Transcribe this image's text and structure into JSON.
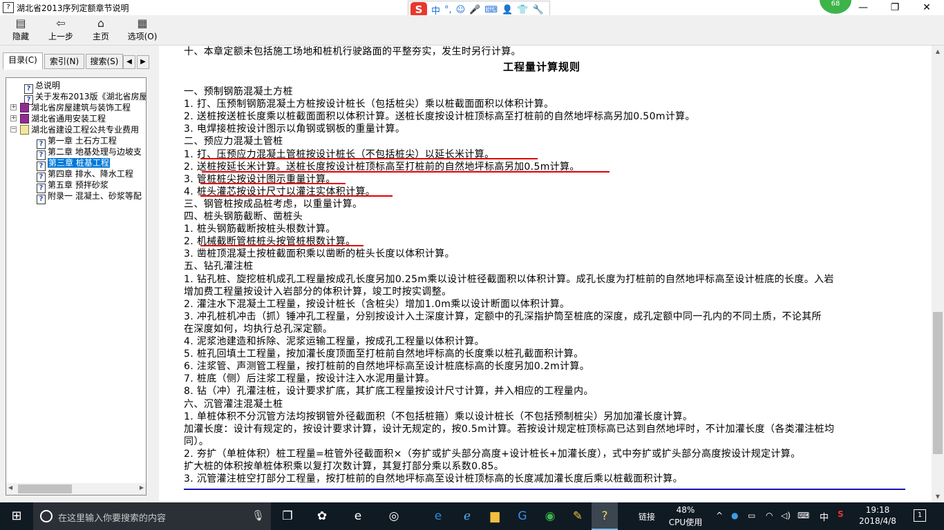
{
  "window": {
    "title": "湖北省2013序列定额章节说明",
    "minimize": "—",
    "restore": "❐",
    "close": "✕"
  },
  "ime": {
    "logo": "S",
    "items": [
      "中",
      "°,",
      "☺",
      "🎤",
      "⌨",
      "👤",
      "👕",
      "🔧"
    ]
  },
  "badge": "68",
  "toolbar": {
    "buttons": [
      {
        "label": "隐藏",
        "icon": "▤"
      },
      {
        "label": "上一步",
        "icon": "⇦"
      },
      {
        "label": "主页",
        "icon": "⌂"
      },
      {
        "label": "选项(O)",
        "icon": "▦"
      }
    ]
  },
  "tabs": [
    {
      "label": "目录(C)"
    },
    {
      "label": "索引(N)"
    },
    {
      "label": "搜索(S)"
    }
  ],
  "tab_arrows": [
    "◀",
    "▶"
  ],
  "tree": [
    {
      "label": "总说明",
      "type": "page",
      "indent": 1
    },
    {
      "label": "关于发布2013版《湖北省房屋",
      "type": "page",
      "indent": 1
    },
    {
      "label": "湖北省房屋建筑与装饰工程",
      "type": "book",
      "indent": 0,
      "expander": "+"
    },
    {
      "label": "湖北省通用安装工程",
      "type": "book",
      "indent": 0,
      "expander": "+"
    },
    {
      "label": "湖北省建设工程公共专业费用",
      "type": "book-open",
      "indent": 0,
      "expander": "−"
    },
    {
      "label": "第一章  土石方工程",
      "type": "page",
      "indent": 2
    },
    {
      "label": "第二章  地基处理与边坡支",
      "type": "page",
      "indent": 2
    },
    {
      "label": "第三章  桩基工程",
      "type": "page",
      "indent": 2,
      "selected": true
    },
    {
      "label": "第四章  排水、降水工程",
      "type": "page",
      "indent": 2
    },
    {
      "label": "第五章  预拌砂浆",
      "type": "page",
      "indent": 2
    },
    {
      "label": "附录一  混凝土、砂浆等配",
      "type": "page",
      "indent": 2
    }
  ],
  "content": {
    "top_line": "十、本章定额未包括施工场地和桩机行驶路面的平整夯实，发生时另行计算。",
    "heading": "工程量计算规则",
    "lines": [
      "一、预制钢筋混凝土方桩",
      "1. 打、压预制钢筋混凝土方桩按设计桩长（包括桩尖）乘以桩截面面积以体积计算。",
      "2. 送桩按送桩长度乘以桩截面面积以体积计算。送桩长度按设计桩顶标高至打桩前的自然地坪标高另加0.50m计算。",
      "3. 电焊接桩按设计图示以角钢或钢板的重量计算。",
      "二、预应力混凝土管桩",
      "1. 打、压预应力混凝土管桩按设计桩长（不包括桩尖）以延长米计算。",
      "2. 送桩按延长米计算。送桩长度按设计桩顶标高至打桩前的自然地坪标高另加0.5m计算。",
      "3. 管桩桩尖按设计图示重量计算。",
      "4. 桩头灌芯按设计尺寸以灌注实体积计算。",
      "三、钢管桩按成品桩考虑，以重量计算。",
      "四、桩头钢筋截断、凿桩头",
      "1. 桩头钢筋截断按桩头根数计算。",
      "2. 机械截断管桩桩头按管桩根数计算。",
      "3. 凿桩顶混凝土按桩截面积乘以凿断的桩头长度以体积计算。",
      "五、钻孔灌注桩",
      "1. 钻孔桩、旋挖桩机成孔工程量按成孔长度另加0.25m乘以设计桩径截面积以体积计算。成孔长度为打桩前的自然地坪标高至设计桩底的长度。入岩",
      "增加费工程量按设计入岩部分的体积计算，竣工时按实调整。",
      "2. 灌注水下混凝土工程量，按设计桩长（含桩尖）增加1.0m乘以设计断面以体积计算。",
      "3. 冲孔桩机冲击（抓）锤冲孔工程量，分别按设计入土深度计算，定额中的孔深指护筒至桩底的深度，成孔定额中同一孔内的不同土质，不论其所",
      "在深度如何，均执行总孔深定额。",
      "4. 泥浆池建造和拆除、泥浆运输工程量，按成孔工程量以体积计算。",
      "5. 桩孔回填土工程量，按加灌长度顶面至打桩前自然地坪标高的长度乘以桩孔截面积计算。",
      "6. 注浆管、声测管工程量，按打桩前的自然地坪标高至设计桩底标高的长度另加0.2m计算。",
      "7. 桩底（侧）后注浆工程量，按设计注入水泥用量计算。",
      "8. 钻（冲）孔灌注桩，设计要求扩底，其扩底工程量按设计尺寸计算，并入相应的工程量内。",
      "六、沉管灌注混凝土桩",
      "1. 单桩体积不分沉管方法均按钢管外径截面积（不包括桩箍）乘以设计桩长（不包括预制桩尖）另加加灌长度计算。",
      "加灌长度：设计有规定的，按设计要求计算，设计无规定的，按0.5m计算。若按设计规定桩顶标高已达到自然地坪时，不计加灌长度（各类灌注桩均",
      "同）。",
      "2. 夯扩（单桩体积）桩工程量=桩管外径截面积×（夯扩或扩头部分高度+设计桩长+加灌长度），式中夯扩或扩头部分高度按设计规定计算。",
      "扩大桩的体积按单桩体积乘以复打次数计算，其复打部分乘以系数0.85。",
      "3. 沉管灌注桩空打部分工程量，按打桩前的自然地坪标高至设计桩顶标高的长度减加灌长度后乘以桩截面积计算。"
    ]
  },
  "taskbar": {
    "search_placeholder": "在这里输入你要搜索的内容",
    "tray_link": "链接",
    "cpu_percent": "48%",
    "cpu_label": "CPU使用",
    "ime_lang": "中",
    "time": "19:18",
    "date": "2018/4/8",
    "notification_count": "1"
  },
  "colors": {
    "annotation_red": "#e00000",
    "selection_blue": "#0078d7",
    "rule_blue": "#1515b5",
    "taskbar": "#101a23"
  }
}
